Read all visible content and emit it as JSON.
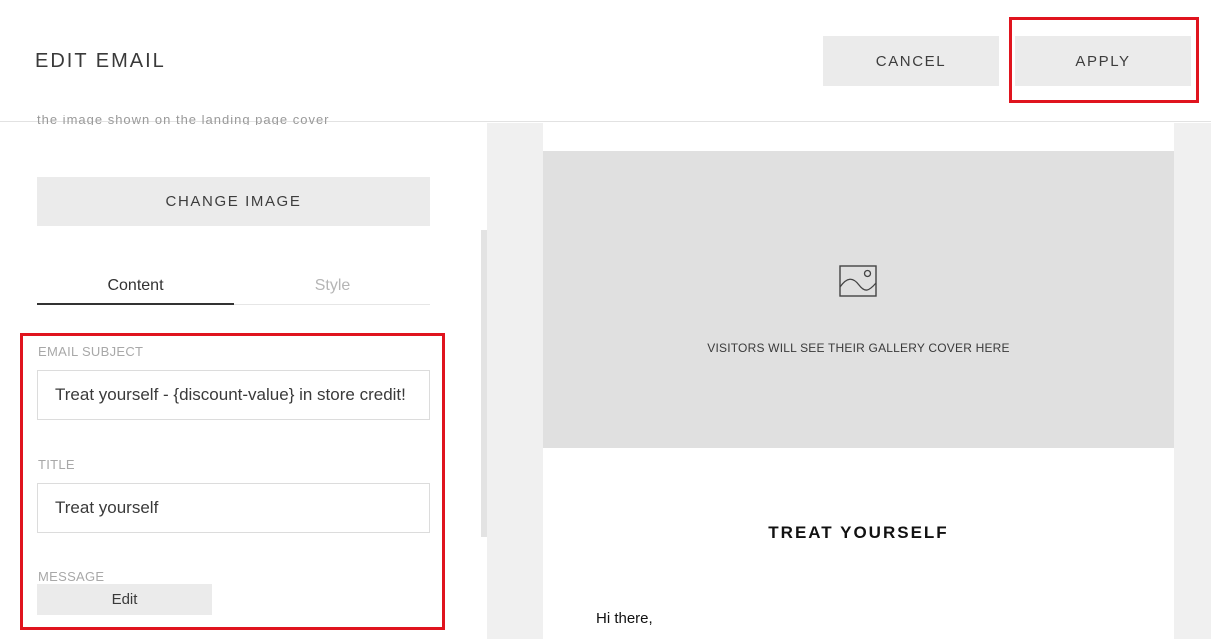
{
  "header": {
    "title": "EDIT EMAIL",
    "cancel_label": "CANCEL",
    "apply_label": "APPLY"
  },
  "editor": {
    "truncated_text": "the image shown on the landing page cover",
    "change_image_label": "CHANGE IMAGE",
    "tabs": [
      {
        "label": "Content",
        "active": true
      },
      {
        "label": "Style",
        "active": false
      }
    ],
    "email_subject_label": "EMAIL SUBJECT",
    "email_subject_value": "Treat yourself - {discount-value} in store credit!",
    "title_label": "TITLE",
    "title_value": "Treat yourself",
    "message_label": "MESSAGE",
    "edit_label": "Edit"
  },
  "preview": {
    "cover_placeholder": "VISITORS WILL SEE THEIR GALLERY COVER HERE",
    "cover_icon": "image-icon",
    "heading": "TREAT YOURSELF",
    "greeting": "Hi there,"
  },
  "colors": {
    "highlight": "#e0141e",
    "button_bg": "#ebebeb",
    "cover_bg": "#e0e0e0",
    "preview_bg": "#f0f0f0"
  }
}
